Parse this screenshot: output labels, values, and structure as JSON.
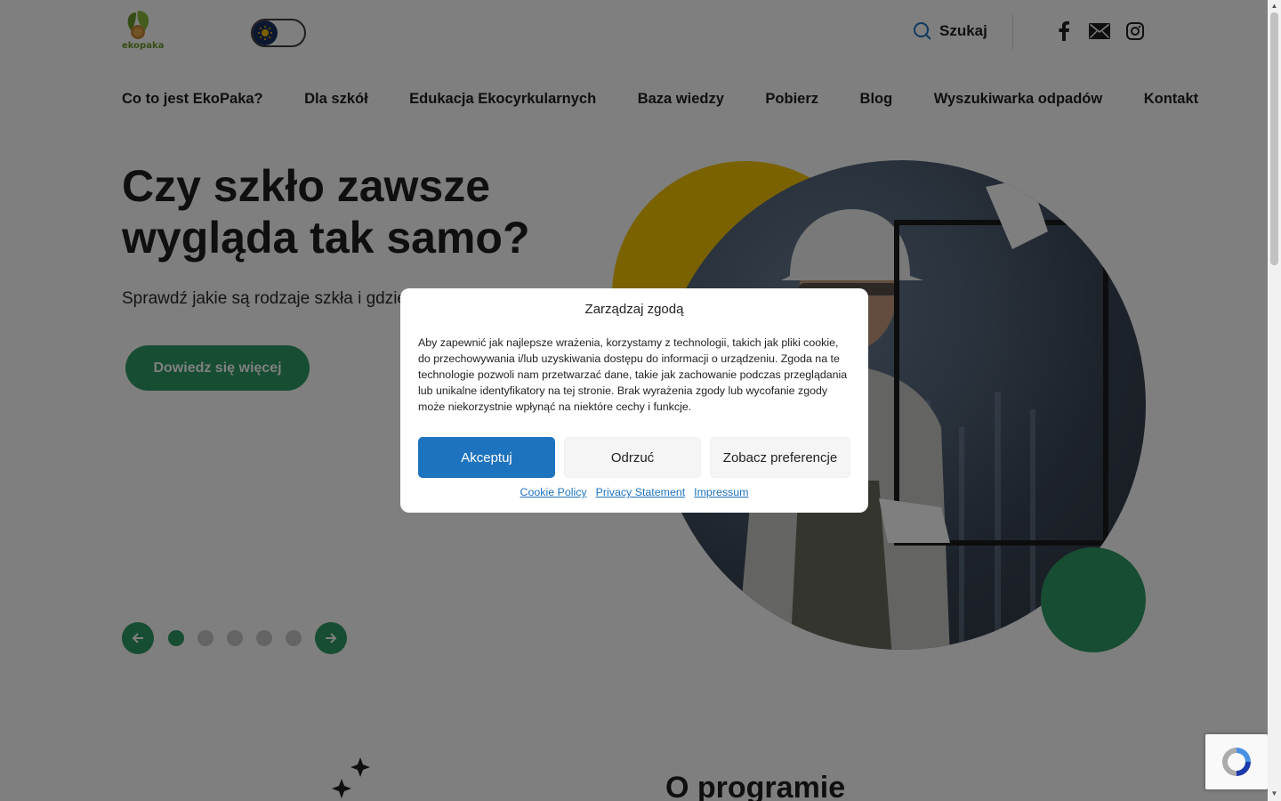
{
  "header": {
    "logo_text": "ekopaka",
    "search_label": "Szukaj"
  },
  "nav": {
    "items": [
      "Co to jest EkoPaka?",
      "Dla szkół",
      "Edukacja Ekocyrkularnych",
      "Baza wiedzy",
      "Pobierz",
      "Blog",
      "Wyszukiwarka odpadów",
      "Kontakt"
    ]
  },
  "hero": {
    "title_line1": "Czy szkło zawsze",
    "title_line2": "wygląda tak samo?",
    "subtitle": "Sprawdź jakie są rodzaje szkła i gdzie",
    "button_label": "Dowiedz się więcej"
  },
  "slider": {
    "total_slides": 5,
    "active_slide": 1
  },
  "about": {
    "title": "O programie"
  },
  "consent": {
    "title": "Zarządzaj zgodą",
    "text": "Aby zapewnić jak najlepsze wrażenia, korzystamy z technologii, takich jak pliki cookie, do przechowywania i/lub uzyskiwania dostępu do informacji o urządzeniu. Zgoda na te technologie pozwoli nam przetwarzać dane, takie jak zachowanie podczas przeglądania lub unikalne identyfikatory na tej stronie. Brak wyrażenia zgody lub wycofanie zgody może niekorzystnie wpłynąć na niektóre cechy i funkcje.",
    "accept_label": "Akceptuj",
    "deny_label": "Odrzuć",
    "prefs_label": "Zobacz preferencje",
    "links": {
      "cookie_policy": "Cookie Policy",
      "privacy": "Privacy Statement",
      "impressum": "Impressum"
    }
  },
  "colors": {
    "brand_green": "#2f9a64",
    "accent_yellow": "#f5c400",
    "accept_blue": "#1e73be"
  },
  "icons": [
    "leaf-logo-icon",
    "sun-icon",
    "search-icon",
    "facebook-icon",
    "mail-icon",
    "instagram-icon",
    "arrow-left-icon",
    "arrow-right-icon",
    "sparkle-icon",
    "recaptcha-icon"
  ]
}
